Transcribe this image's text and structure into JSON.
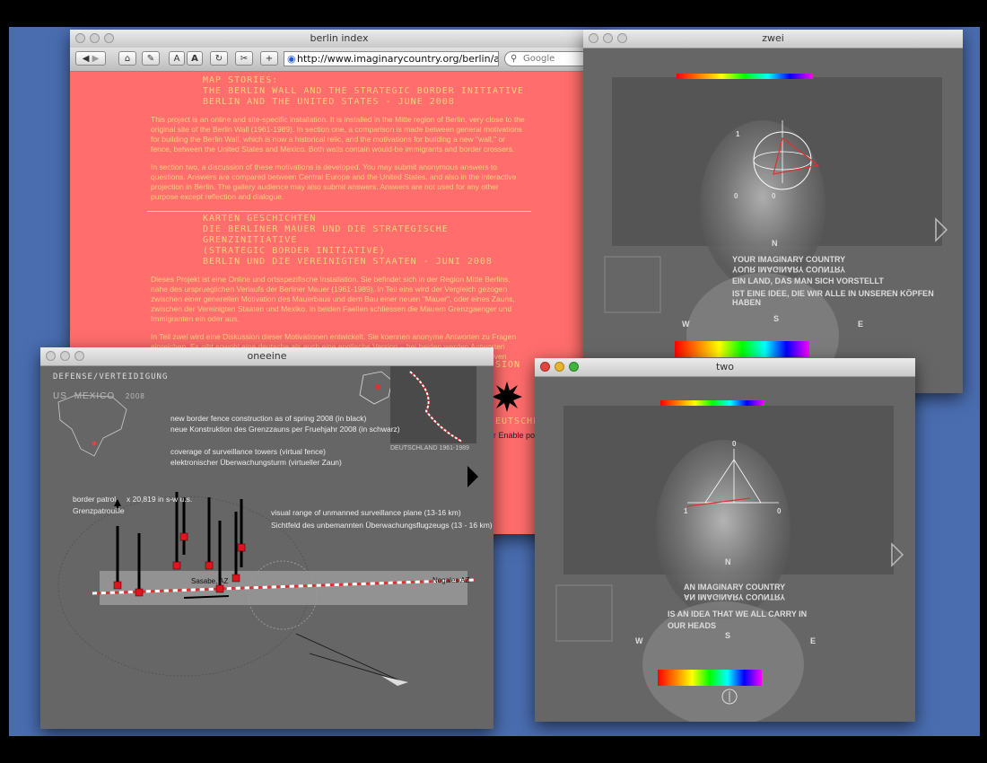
{
  "windows": {
    "berlin": {
      "title": "berlin index",
      "url": "http://www.imaginarycountry.org/berlin/aaainde",
      "search_placeholder": "Google",
      "toolbar": {
        "font_small": "A",
        "font_large": "A"
      },
      "en_heading": [
        "MAP STORIES:",
        "THE BERLIN WALL AND THE STRATEGIC BORDER INITIATIVE",
        "BERLIN AND THE UNITED STATES - JUNE 2008"
      ],
      "en_p1": "This project is an online and site-specific installation. It is installed in the Mitte region of Berlin, very close to the original site of the Berlin Wall (1961-1989). In section one, a comparison is made between general motivations for building the Berlin Wall, which is now a historical relic, and the motivations for building a new \"wall,\" or fence, between the United States and Mexico.  Both walls contain would-be immigrants and border crossers.",
      "en_p2": "In section two, a discussion of these motivations is developed. You may submit anonymous answers to questions. Answers are compared between Central Europe and the United States, and also in the interactive projection in Berlin. The gallery audience may also submit answers. Answers are not used for any other purpose except reflection and dialogue.",
      "de_heading": [
        "KARTEN GESCHICHTEN",
        "DIE BERLINER MAUER UND DIE STRATEGISCHE GRENZINITIATIVE",
        "(STRATEGIC BORDER INITIATIVE)",
        "BERLIN UND DIE VEREINIGTEN STAATEN - JUNI 2008"
      ],
      "de_p1": "Dieses Projekt ist eine Online und  ortsspezifische Installation.  Sie befindet sich in der Region Mitte Berlins, nahe des ursprueglichen Verlaufs der Berliner Mauer (1961-1989). In Teil eins wird der Vergleich gezogen zwischen einer generellen Motivation des Mauerbaus und dem Bau einer neuen \"Mauer\", oder eines Zauns, zwischen der Vereinigten Staaten und Mexiko.  In beiden Faellen schliessen die Mauern Grenzgaenger und Immigranten ein oder aus.",
      "de_p2": "In Teil zwei wird eine Diskussion dieser Motivationen entwickelt.  Sie koennen anonyme Antworten zu Fragen einreichen.  Es gibt sowohl eine deutsche als auch eine englische Version – bei beiden werden Antworten zwischen Zentraleuropa und den Vereinigten Staaten verglichen.  Das geschieht auch in einer interaktiven Projektion in der Gallerie in Berlin. Das Publikum in der Gallerie kann auch Antworten einreichen.  Alle Antworten sind anonym und",
      "fragment_sion": "SION",
      "fragment_deutsche": "EUTSCHE)",
      "fragment_link": "Enable po"
    },
    "zwei": {
      "title": "zwei",
      "north": "N",
      "west": "W",
      "south": "S",
      "east": "E",
      "line1": "YOUR IMAGINARY COUNTRY",
      "line2": "YOUR IMAGINARY COUNTRY",
      "line3": "EIN LAND, DAS MAN SICH VORSTELLT",
      "line4": "IST EINE IDEE, DIE WIR ALLE IN UNSEREN KÖPFEN HABEN",
      "axis_1": "1",
      "axis_0": "0",
      "axis_0b": "0"
    },
    "two": {
      "title": "two",
      "north": "N",
      "west": "W",
      "south": "S",
      "east": "E",
      "line1": "AN IMAGINARY COUNTRY",
      "line2": "AN IMAGINARY COUNTRY",
      "line3": "IS AN IDEA THAT WE ALL CARRY IN",
      "line4": "OUR HEADS",
      "axis_0": "0",
      "axis_1": "1",
      "axis_0b": "0"
    },
    "oneeine": {
      "title": "oneeine",
      "header": "DEFENSE/VERTEIDIGUNG",
      "region_us": "US",
      "region_mexico": "MEXICO",
      "year": "2008",
      "inset_caption": "DEUTSCHLAND  1961-1989",
      "fence_en": "new border fence construction as of spring 2008 (in black)",
      "fence_de": "neue Konstruktion des Grenzzauns per Fruehjahr 2008 (in schwarz)",
      "towers_en": "coverage of surveillance towers (virtual fence)",
      "towers_de": "elektronischer Überwachungsturm (virtueller Zaun)",
      "patrol_en": "border patrol",
      "patrol_count": "x 20,819 in s-w u.s.",
      "patrol_de": "Grenzpatrouille",
      "plane_en": "visual range of unmanned surveillance plane (13-16 km)",
      "plane_de": "Sichtfeld des unbemannten Überwachungsflugzeugs (13 - 16 km)",
      "place_sasabe": "Sasabe, AZ",
      "place_nogales": "Nogales AZ"
    }
  }
}
